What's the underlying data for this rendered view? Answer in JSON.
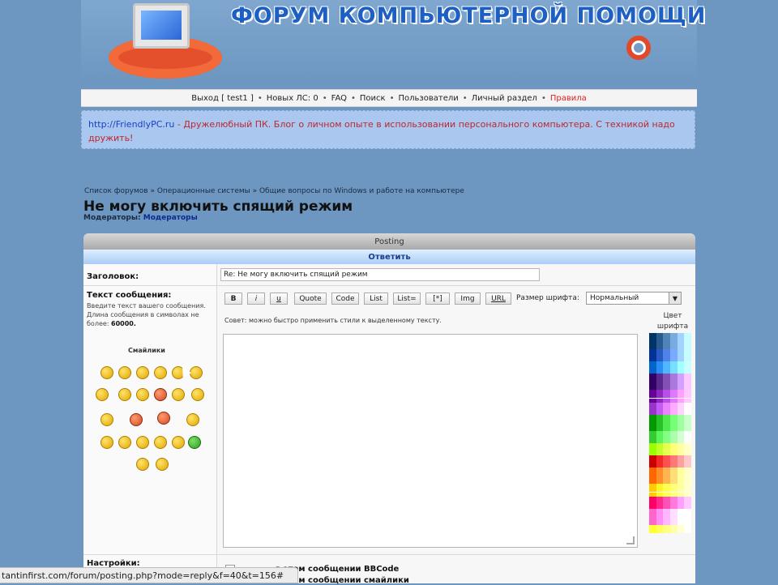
{
  "header": {
    "site_title": "ФОРУМ КОМПЬЮТЕРНОЙ ПОМОЩИ"
  },
  "nav": {
    "logout": "Выход [ test1 ]",
    "new_pm": "Новых ЛС: 0",
    "faq": "FAQ",
    "search": "Поиск",
    "users": "Пользователи",
    "private": "Личный раздел",
    "rules": "Правила",
    "separator": "•"
  },
  "announcement": {
    "link": "http://FriendlyPC.ru",
    "text": " - Дружелюбный ПК. Блог о личном опыте в использовании персонального компьютера. С техникой надо дружить!"
  },
  "breadcrumb": "Список форумов » Операционные системы » Общие вопросы по Windows и работе на компьютере",
  "topic_title": "Не могу включить спящий режим",
  "moderators": {
    "label": "Модераторы:",
    "link": "Модераторы"
  },
  "panel": {
    "header": "Posting",
    "subheader": "Ответить"
  },
  "form": {
    "subject_label": "Заголовок:",
    "subject_value": "Re: Не могу включить спящий режим",
    "message_label": "Текст сообщения:",
    "message_hint": "Введите текст вашего сообщения. Длина сообщения в символах не более: ",
    "message_limit": "60000.",
    "smilies_title": "Смайлики",
    "toolbar": [
      "B",
      "i",
      "u",
      "Quote",
      "Code",
      "List",
      "List=",
      "[*]",
      "Img",
      "URL"
    ],
    "font_size_label": "Размер шрифта:",
    "font_size_value": "Нормальный",
    "tip": "Совет: можно быстро применить стили к выделенному тексту.",
    "color_label": "Цвет шрифта",
    "settings_label": "Настройки:",
    "option1": "в этом сообщении BBCode",
    "option2": "в этом сообщении смайлики"
  },
  "statusbar": {
    "url": "tantinfirst.com/forum/posting.php?mode=reply&f=40&t=156#"
  },
  "colors": {
    "background": "#6d97c1",
    "rules_red": "#d22222",
    "announce_bg": "#a9c7ef"
  }
}
